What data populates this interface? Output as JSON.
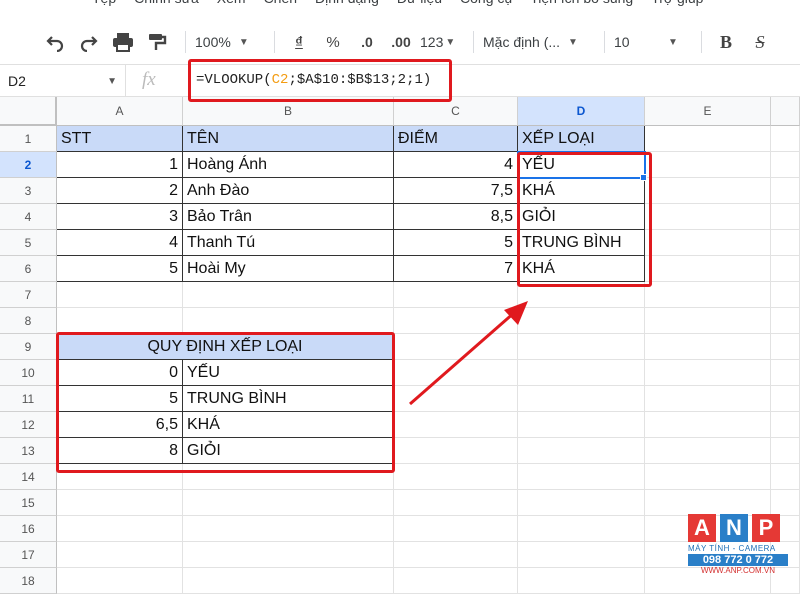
{
  "menu": [
    "Tệp",
    "Chỉnh sửa",
    "Xem",
    "Chèn",
    "Định dạng",
    "Dữ liệu",
    "Công cụ",
    "Tiện ích bổ sung",
    "Trợ giúp"
  ],
  "toolbar": {
    "zoom": "100%",
    "currency": "₫",
    "percent": "%",
    "decimal_decrease": ".0",
    "decimal_increase": ".00",
    "number_format": "123",
    "font": "Mặc định (...",
    "font_size": "10",
    "bold": "B",
    "strike": "S"
  },
  "formula_bar": {
    "name_box": "D2",
    "fx": "fx",
    "formula_prefix": "=VLOOKUP(",
    "formula_ref": "C2",
    "formula_sep1": ";",
    "formula_range": "$A$10:$B$13",
    "formula_sep2": ";",
    "formula_col": "2",
    "formula_sep3": ";",
    "formula_match": "1",
    "formula_suffix": ")"
  },
  "columns": [
    "A",
    "B",
    "C",
    "D",
    "E"
  ],
  "rows": [
    "1",
    "2",
    "3",
    "4",
    "5",
    "6",
    "7",
    "8",
    "9",
    "10",
    "11",
    "12",
    "13",
    "14",
    "15",
    "16",
    "17",
    "18"
  ],
  "table": {
    "headers": [
      "STT",
      "TÊN",
      "ĐIỂM",
      "XẾP LOẠI"
    ],
    "rows": [
      [
        "1",
        "Hoàng Ánh",
        "4",
        "YẾU"
      ],
      [
        "2",
        "Anh Đào",
        "7,5",
        "KHÁ"
      ],
      [
        "3",
        "Bảo Trân",
        "8,5",
        "GIỎI"
      ],
      [
        "4",
        "Thanh Tú",
        "5",
        "TRUNG BÌNH"
      ],
      [
        "5",
        "Hoài My",
        "7",
        "KHÁ"
      ]
    ]
  },
  "rules": {
    "title": "QUY ĐỊNH XẾP LOẠI",
    "rows": [
      [
        "0",
        "YẾU"
      ],
      [
        "5",
        "TRUNG BÌNH"
      ],
      [
        "6,5",
        "KHÁ"
      ],
      [
        "8",
        "GIỎI"
      ]
    ]
  },
  "logo": {
    "letters": [
      "A",
      "N",
      "P"
    ],
    "tagline": "MÁY TÍNH - CAMERA",
    "phone": "098 772 0 772",
    "website": "WWW.ANP.COM.VN"
  },
  "colors": {
    "header_fill": "#c9daf8",
    "highlight_red": "#e0191e",
    "selection_blue": "#1a73e8",
    "logo_blue": "#2a7fc8",
    "logo_red": "#e53935"
  }
}
